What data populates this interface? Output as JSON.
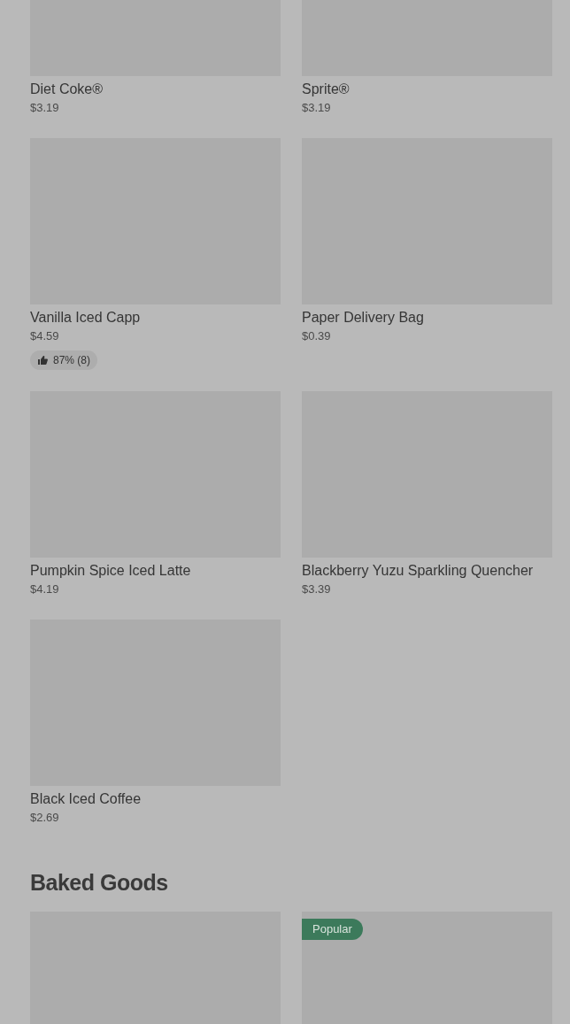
{
  "sections": [
    {
      "items": [
        {
          "name": "Diet Coke®",
          "price": "$3.19"
        },
        {
          "name": "Sprite®",
          "price": "$3.19"
        },
        {
          "name": "Vanilla Iced Capp",
          "price": "$4.59",
          "rating": "87% (8)",
          "popular": false
        },
        {
          "name": "Paper Delivery Bag",
          "price": "$0.39",
          "popular": false
        },
        {
          "name": "Pumpkin Spice Iced Latte",
          "price": "$4.19",
          "popular": false
        },
        {
          "name": "Blackberry Yuzu Sparkling Quencher",
          "price": "$3.39",
          "popular": false
        },
        {
          "name": "Black Iced Coffee",
          "price": "$2.69",
          "popular": false
        }
      ]
    },
    {
      "title": "Baked Goods",
      "items": [
        {
          "popular": false
        },
        {
          "popular": true,
          "badge": "Popular"
        }
      ]
    }
  ]
}
